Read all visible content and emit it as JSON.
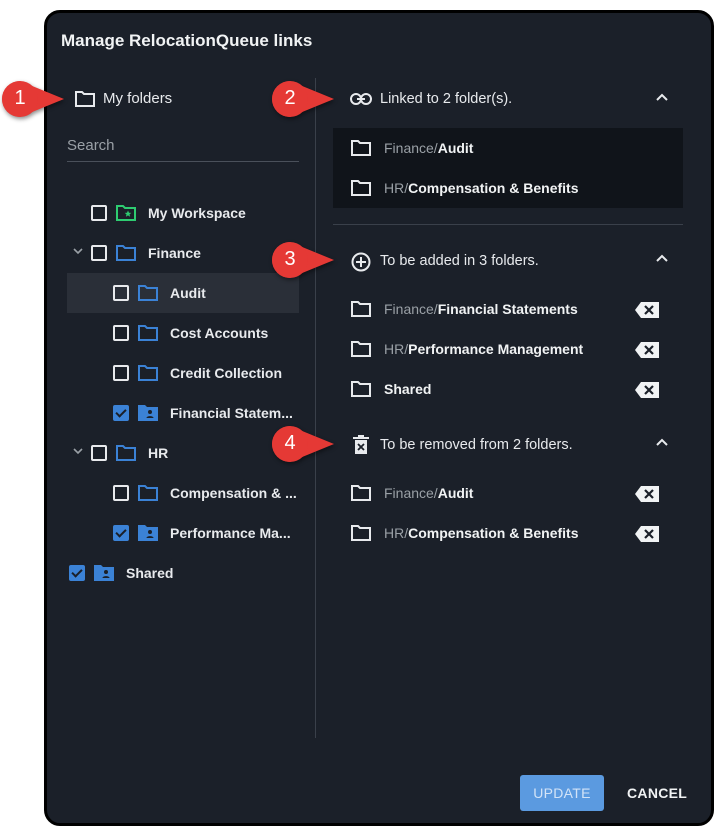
{
  "dialog": {
    "title": "Manage RelocationQueue links"
  },
  "left_panel": {
    "header": "My folders",
    "search_placeholder": "Search",
    "tree": [
      {
        "label": "My Workspace",
        "checked": false,
        "folder_icon": "workspace-folder-icon"
      },
      {
        "label": "Finance",
        "checked": false,
        "expanded": true,
        "folder_icon": "folder-outline-icon"
      },
      {
        "label": "Audit",
        "checked": false,
        "folder_icon": "folder-outline-icon",
        "highlighted": true
      },
      {
        "label": "Cost Accounts",
        "checked": false,
        "folder_icon": "folder-outline-icon"
      },
      {
        "label": "Credit Collection",
        "checked": false,
        "folder_icon": "folder-outline-icon"
      },
      {
        "label": "Financial Statem...",
        "checked": true,
        "folder_icon": "shared-folder-icon"
      },
      {
        "label": "HR",
        "checked": false,
        "expanded": true,
        "folder_icon": "folder-outline-icon"
      },
      {
        "label": "Compensation & ...",
        "checked": false,
        "folder_icon": "folder-outline-icon"
      },
      {
        "label": "Performance Ma...",
        "checked": true,
        "folder_icon": "shared-folder-icon"
      },
      {
        "label": "Shared",
        "checked": true,
        "folder_icon": "shared-folder-icon"
      }
    ]
  },
  "right_panel": {
    "linked": {
      "title": "Linked to 2 folder(s).",
      "items": [
        {
          "parent": "Finance/",
          "leaf": "Audit"
        },
        {
          "parent": "HR/",
          "leaf": "Compensation & Benefits"
        }
      ]
    },
    "to_add": {
      "title": "To be added in 3 folders.",
      "items": [
        {
          "parent": "Finance/",
          "leaf": "Financial Statements"
        },
        {
          "parent": "HR/",
          "leaf": "Performance Management"
        },
        {
          "parent": "",
          "leaf": "Shared"
        }
      ]
    },
    "to_remove": {
      "title": "To be removed from 2 folders.",
      "items": [
        {
          "parent": "Finance/",
          "leaf": "Audit"
        },
        {
          "parent": "HR/",
          "leaf": "Compensation & Benefits"
        }
      ]
    }
  },
  "footer": {
    "update_label": "UPDATE",
    "cancel_label": "CANCEL"
  },
  "callouts": [
    "1",
    "2",
    "3",
    "4"
  ],
  "colors": {
    "accent": "#3b82d6",
    "callout": "#e53935",
    "workspace": "#2ecc71",
    "background": "#1b2029"
  }
}
